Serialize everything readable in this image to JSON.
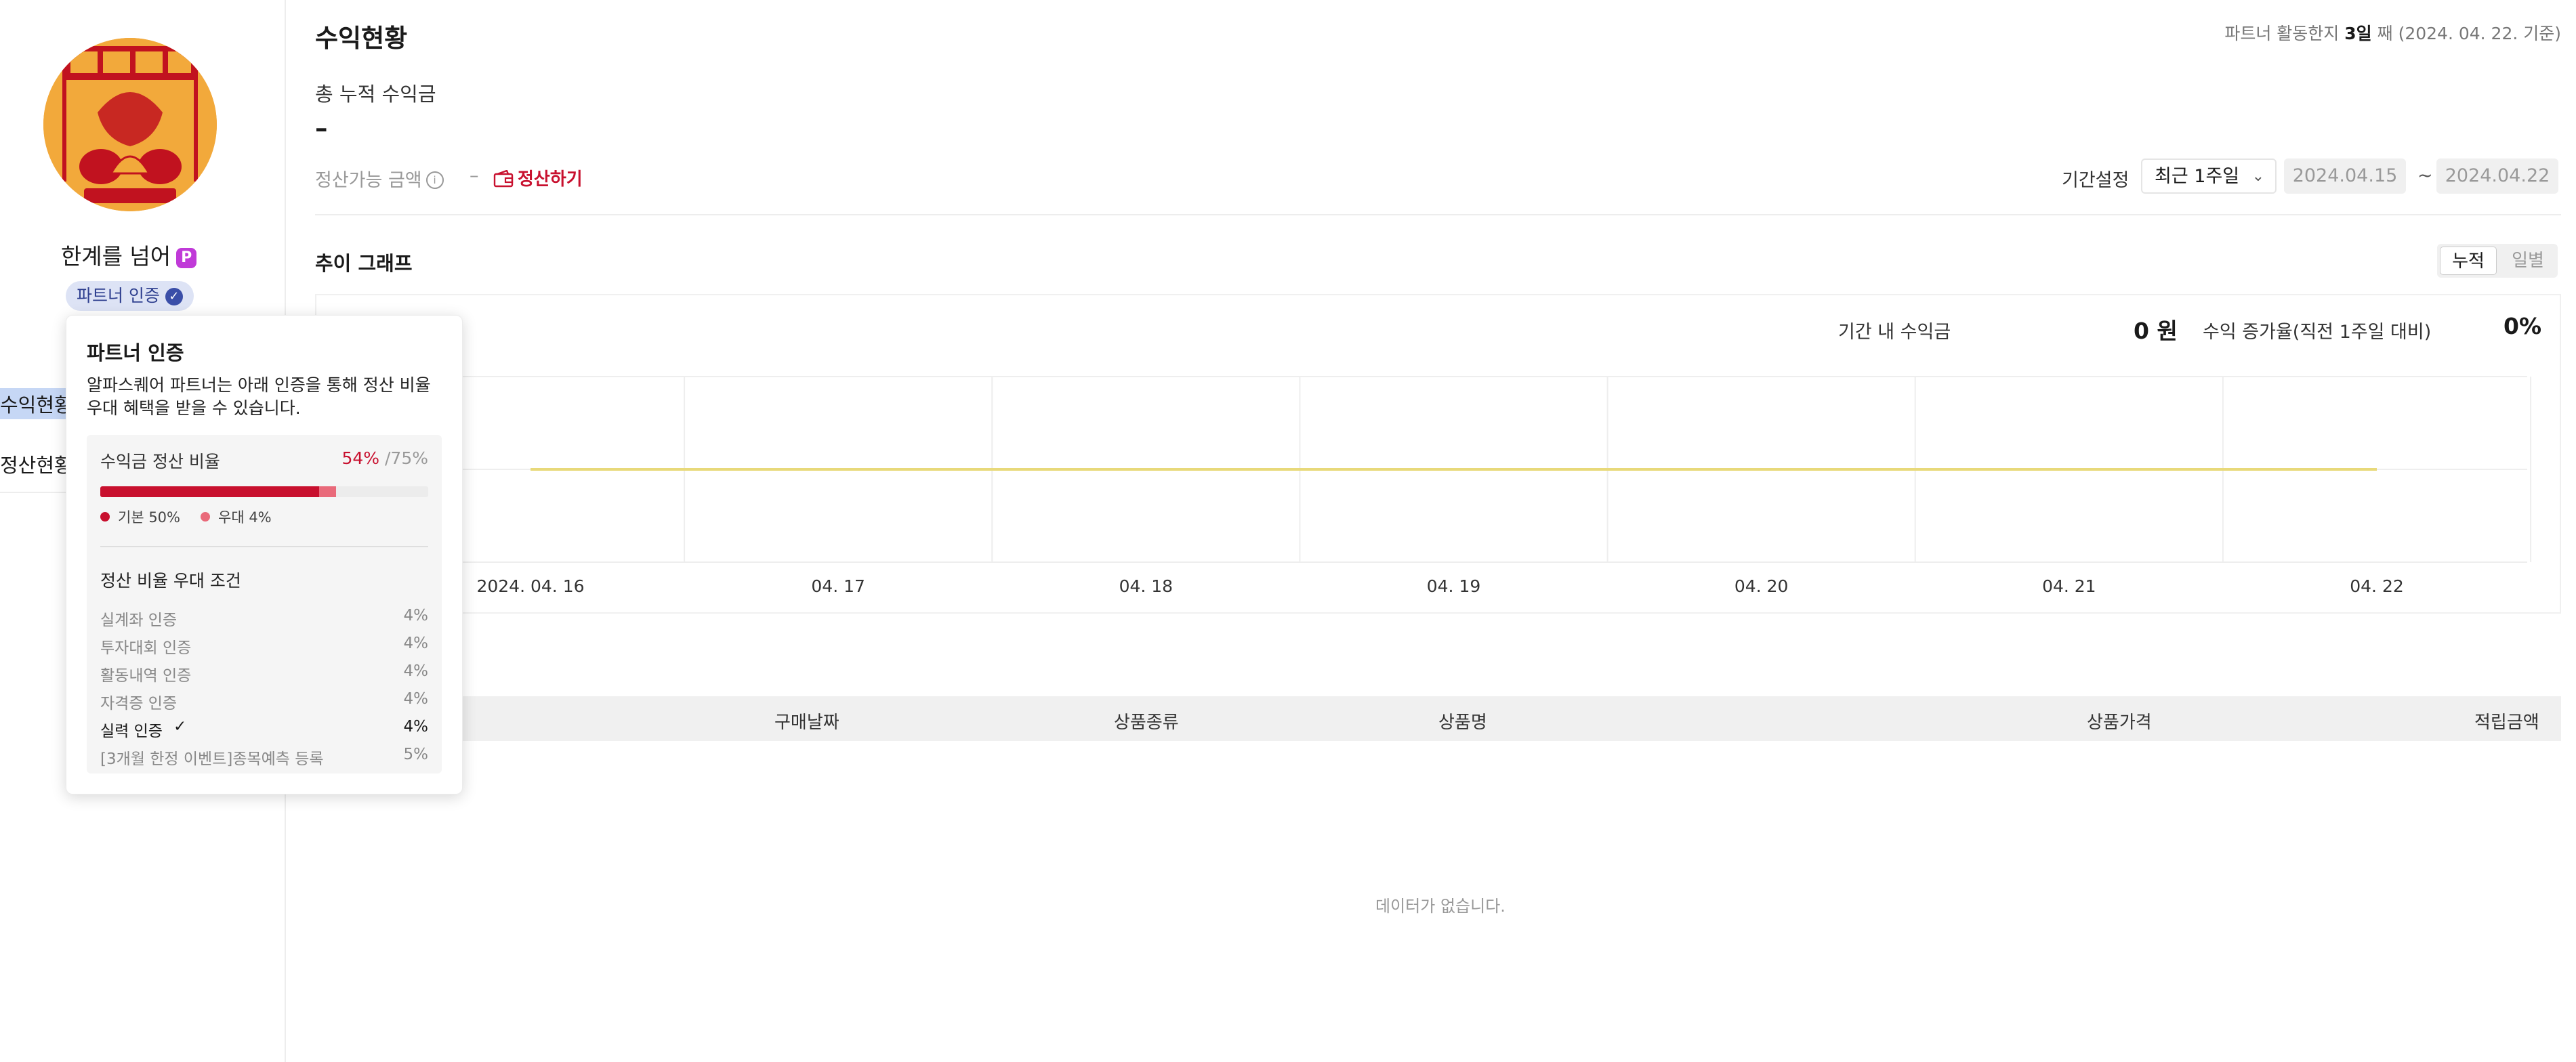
{
  "sidebar": {
    "profile_name": "한계를 넘어",
    "profile_badge": "P",
    "partner_badge": "파트너 인증",
    "menu": [
      "수익현황",
      "정산현황"
    ]
  },
  "popover": {
    "title": "파트너 인증",
    "description": "알파스퀘어 파트너는 아래 인증을 통해 정산 비율 우대 혜택을 받을 수 있습니다.",
    "rate_label": "수익금 정산 비율",
    "rate_current": "54%",
    "rate_max": "/75%",
    "rate_basic_fraction": 0.5,
    "rate_bonus_fraction": 0.04,
    "rate_scale_max": 0.75,
    "legend_basic": "기본 50%",
    "legend_bonus": "우대 4%",
    "conditions_title": "정산 비율 우대 조건",
    "conditions": [
      {
        "name": "실계좌 인증",
        "value": "4%",
        "active": false
      },
      {
        "name": "투자대회 인증",
        "value": "4%",
        "active": false
      },
      {
        "name": "활동내역 인증",
        "value": "4%",
        "active": false
      },
      {
        "name": "자격증 인증",
        "value": "4%",
        "active": false
      },
      {
        "name": "실력 인증",
        "value": "4%",
        "active": true
      },
      {
        "name": "[3개월 한정 이벤트]종목예측 등록",
        "value": "5%",
        "active": false
      }
    ]
  },
  "header": {
    "title": "수익현황",
    "activity_prefix": "파트너 활동한지 ",
    "activity_days": "3일",
    "activity_suffix": " 째 (2024. 04. 22. 기준)"
  },
  "summary": {
    "total_label": "총 누적 수익금",
    "total_value": "–",
    "settle_label": "정산가능 금액",
    "settle_value": "–",
    "settle_button": "정산하기",
    "period_label": "기간설정",
    "period_select": "최근 1주일",
    "date_from": "2024.04.15",
    "date_to": "2024.04.22",
    "date_sep": "~"
  },
  "trend": {
    "title": "추이 그래프",
    "toggle_cumulative": "누적",
    "toggle_daily": "일별",
    "kpi_period_label": "기간 내 수익금",
    "kpi_period_value": "0 원",
    "kpi_growth_label": "수익 증가율(직전 1주일 대비)",
    "kpi_growth_value": "0%"
  },
  "chart_data": {
    "type": "line",
    "categories": [
      "2024. 04. 16",
      "04. 17",
      "04. 18",
      "04. 19",
      "04. 20",
      "04. 21",
      "04. 22"
    ],
    "series": [
      {
        "values": [
          0,
          0,
          0,
          0,
          0,
          0,
          0
        ]
      }
    ],
    "grid": true,
    "line_color": "#e8d97a"
  },
  "table": {
    "columns": [
      "구매날짜",
      "상품종류",
      "상품명",
      "상품가격",
      "적립금액"
    ],
    "rows": [],
    "empty_message": "데이터가 없습니다."
  },
  "colors": {
    "accent": "#c8102e",
    "accent_light": "#e96a7a",
    "partner_badge_bg": "#dde3f5",
    "partner_badge_text": "#2e3f8f"
  }
}
